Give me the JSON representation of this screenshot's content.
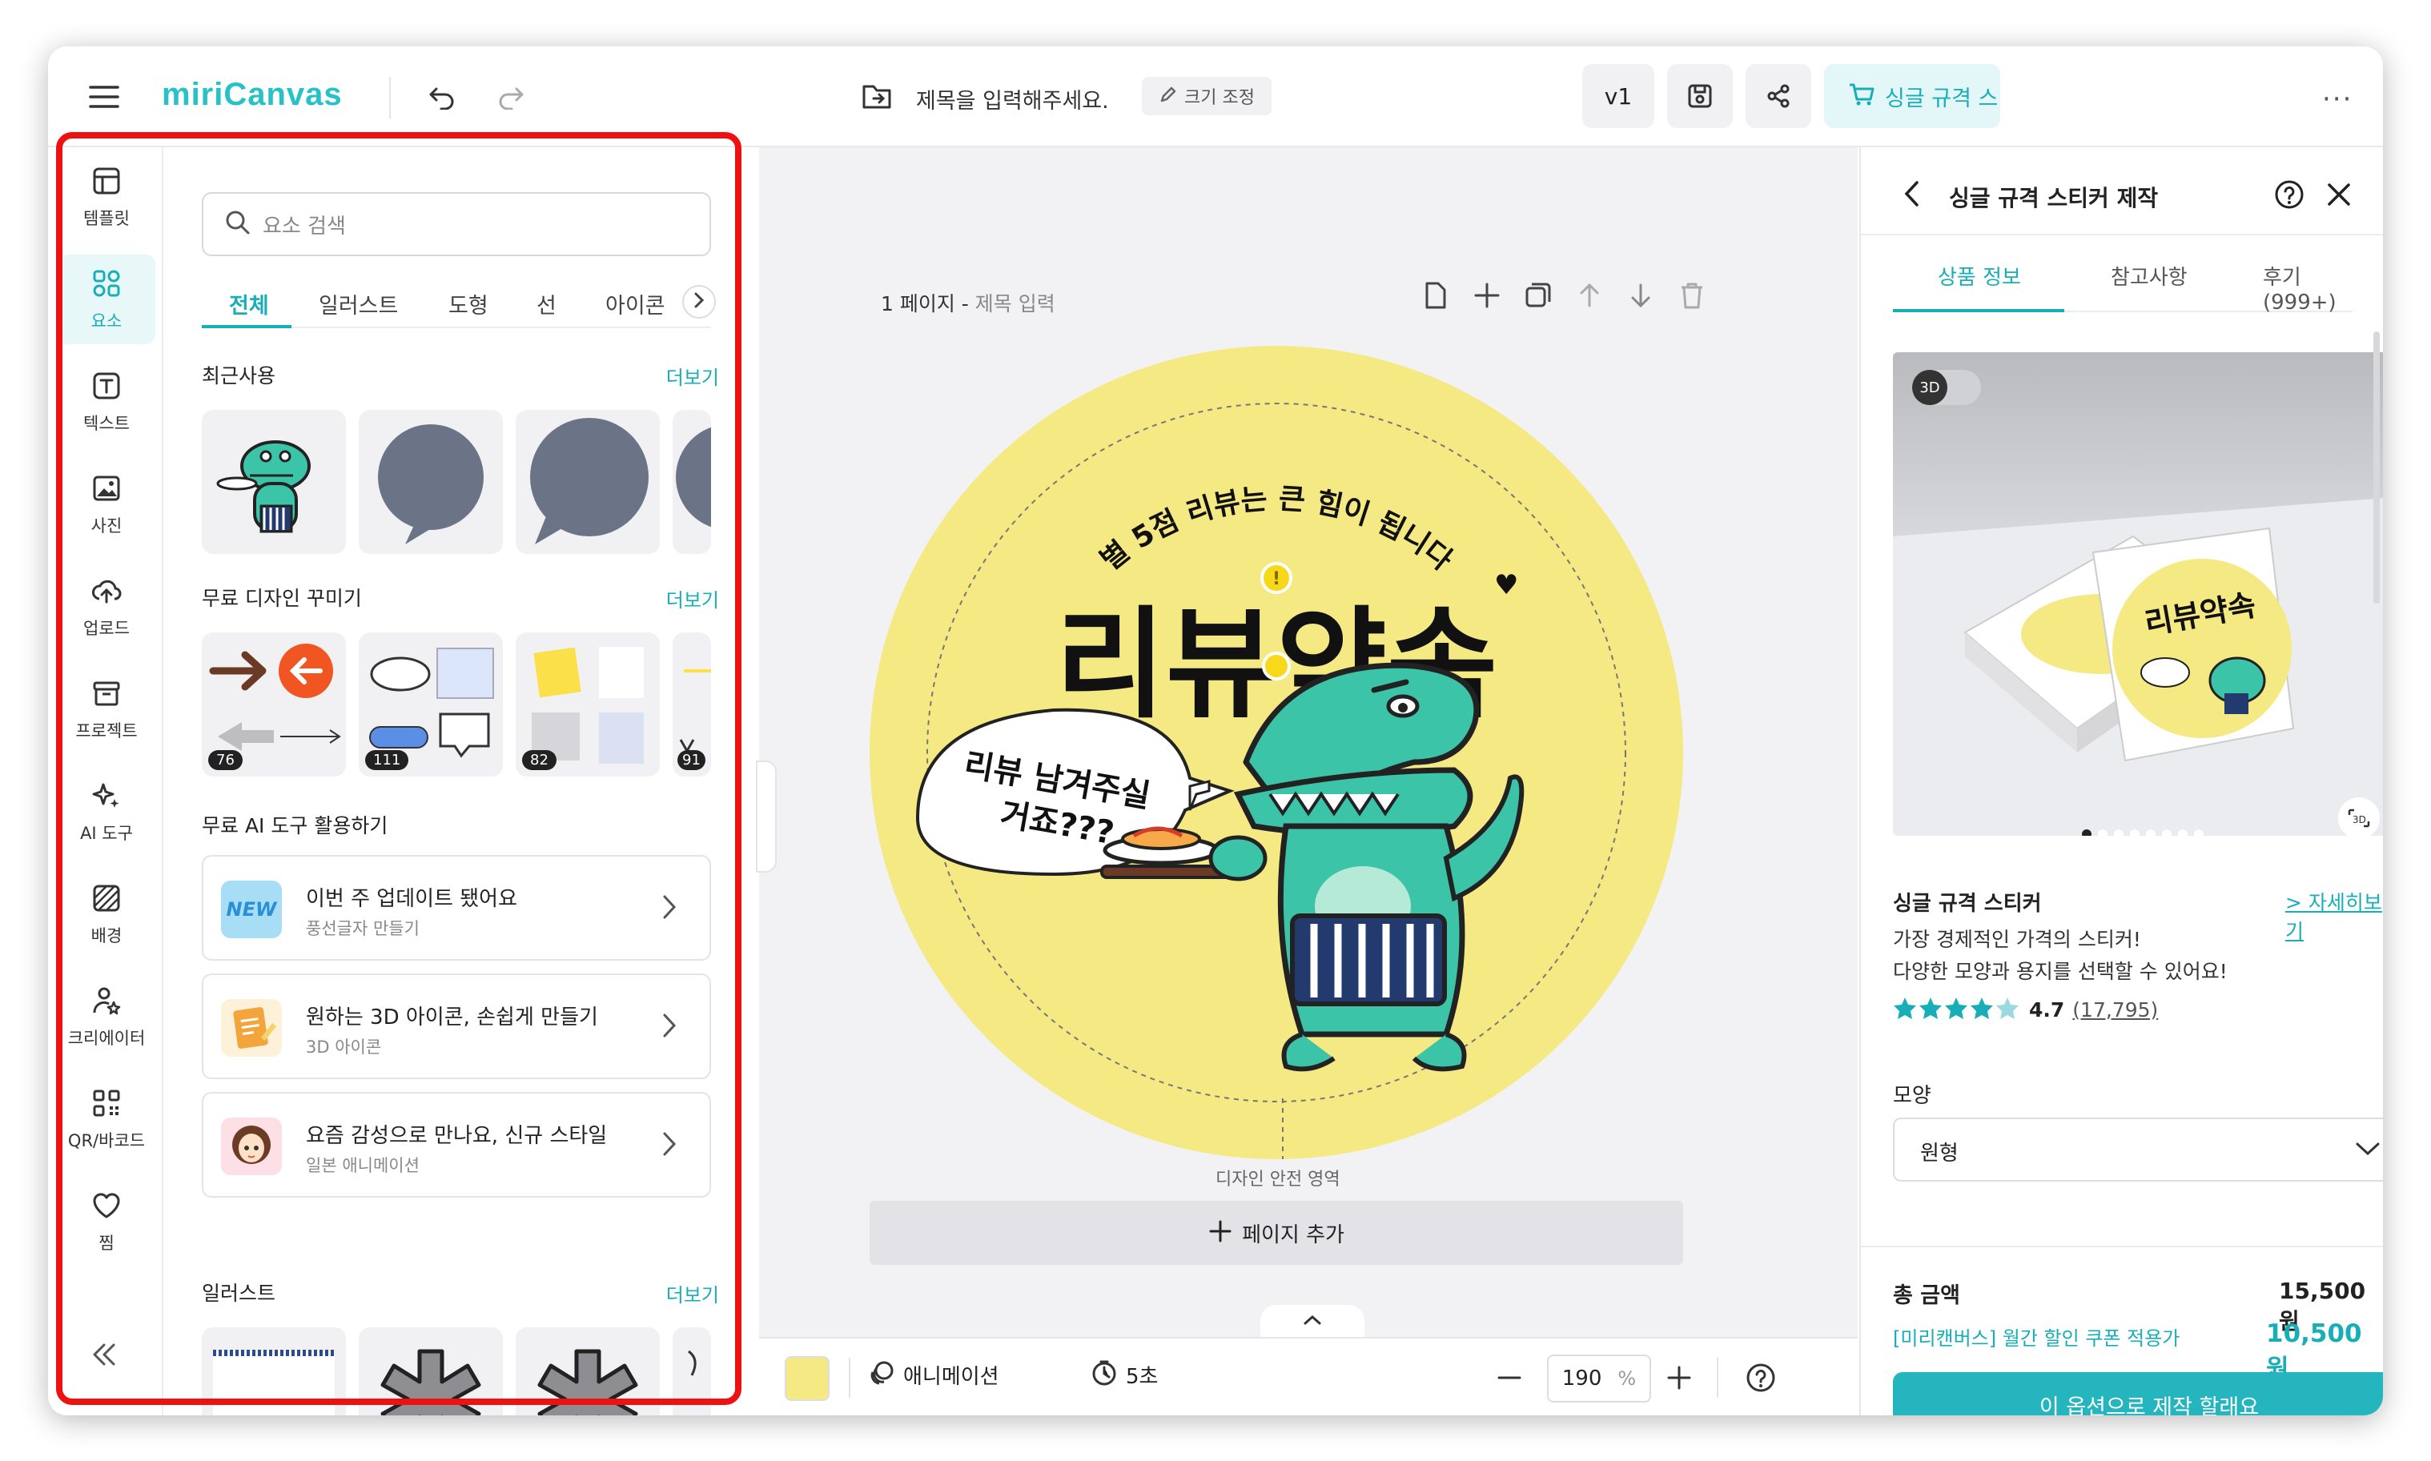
{
  "app": {
    "logo": "miriCanvas"
  },
  "topbar": {
    "title_placeholder": "제목을 입력해주세요.",
    "resize_label": "크기 조정",
    "version_label": "v1",
    "cart_label": "싱글 규격 스"
  },
  "rail": {
    "items": [
      {
        "label": "템플릿",
        "icon": "template-icon"
      },
      {
        "label": "요소",
        "icon": "elements-icon"
      },
      {
        "label": "텍스트",
        "icon": "text-icon"
      },
      {
        "label": "사진",
        "icon": "photo-icon"
      },
      {
        "label": "업로드",
        "icon": "upload-icon"
      },
      {
        "label": "프로젝트",
        "icon": "project-icon"
      },
      {
        "label": "AI 도구",
        "icon": "ai-tool-icon"
      },
      {
        "label": "배경",
        "icon": "background-icon"
      },
      {
        "label": "크리에이터",
        "icon": "creator-icon"
      },
      {
        "label": "QR/바코드",
        "icon": "qr-icon"
      },
      {
        "label": "찜",
        "icon": "heart-icon"
      }
    ]
  },
  "panel": {
    "search_placeholder": "요소 검색",
    "tabs": [
      "전체",
      "일러스트",
      "도형",
      "선",
      "아이콘"
    ],
    "recent_title": "최근사용",
    "more_label": "더보기",
    "decor_title": "무료 디자인 꾸미기",
    "decor_counts": [
      "76",
      "111",
      "82",
      "91"
    ],
    "ai_title": "무료 AI 도구 활용하기",
    "ai_cards": [
      {
        "title": "이번 주 업데이트 됐어요",
        "subtitle": "풍선글자 만들기",
        "badge": "NEW"
      },
      {
        "title": "원하는 3D 아이콘, 손쉽게 만들기",
        "subtitle": "3D 아이콘"
      },
      {
        "title": "요즘 감성으로 만나요, 신규 스타일",
        "subtitle": "일본 애니메이션"
      }
    ],
    "illust_title": "일러스트"
  },
  "canvas": {
    "page_label": "1 페이지 - ",
    "page_title_placeholder": "제목 입력",
    "sticker": {
      "arc_text": "별 5점 리뷰는 큰 힘이 됩니다",
      "heart": "♥",
      "headline": "리뷰약속",
      "bubble_line1": "리뷰 남겨주실",
      "bubble_line2": "거죠???"
    },
    "safe_area_label": "디자인 안전 영역",
    "add_page_label": "페이지 추가"
  },
  "bottombar": {
    "animation_label": "애니메이션",
    "duration_label": "5초",
    "zoom_value": "190",
    "zoom_unit": "%"
  },
  "right_panel": {
    "title": "싱글 규격 스티커 제작",
    "tabs": [
      "상품 정보",
      "참고사항",
      "후기 (999+)"
    ],
    "badge_3d": "3D",
    "mock_headline": "리뷰약속",
    "product_name": "싱글 규격 스티커",
    "detail_link": "> 자세히보기",
    "desc_line1": "가장 경제적인 가격의 스티커!",
    "desc_line2": "다양한 모양과 용지를 선택할 수 있어요!",
    "rating": "4.7",
    "review_count": "(17,795)",
    "rating_stars": 4.5,
    "shape_label": "모양",
    "shape_value": "원형",
    "total_label": "총 금액",
    "total_price": "15,500원",
    "coupon_label": "[미리캔버스] 월간 할인 쿠폰 적용가",
    "discount_price": "10,500원",
    "cta_label": "이 옵션으로 제작 할래요"
  },
  "colors": {
    "accent": "#18aeb8",
    "sticker_yellow": "#f5e984",
    "crocodile": "#3cc4a8",
    "highlight": "#ee1111"
  }
}
